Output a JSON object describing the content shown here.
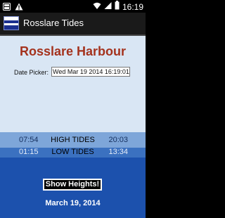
{
  "status_bar": {
    "time": "16:19",
    "icons": [
      "notification-icon",
      "warning-icon",
      "wifi-icon",
      "signal-icon",
      "battery-icon"
    ]
  },
  "title_bar": {
    "app_title": "Rosslare Tides",
    "icon": "tide-app-icon"
  },
  "main": {
    "harbour_name": "Rosslare Harbour",
    "date_picker_label": "Date Picker:",
    "date_picker_value": "Wed Mar 19 2014 16:19:01",
    "high_tides": {
      "label": "HIGH TIDES",
      "time1": "07:54",
      "time2": "20:03"
    },
    "low_tides": {
      "label": "LOW TIDES",
      "time1": "01:15",
      "time2": "13:34"
    },
    "show_heights_label": "Show Heights!",
    "date_heading": "March 19, 2014"
  },
  "colors": {
    "harbour_text": "#a4321d",
    "background": "#d9e6f4",
    "high_band": "#7ea6d9",
    "low_band": "#1c51ad"
  }
}
